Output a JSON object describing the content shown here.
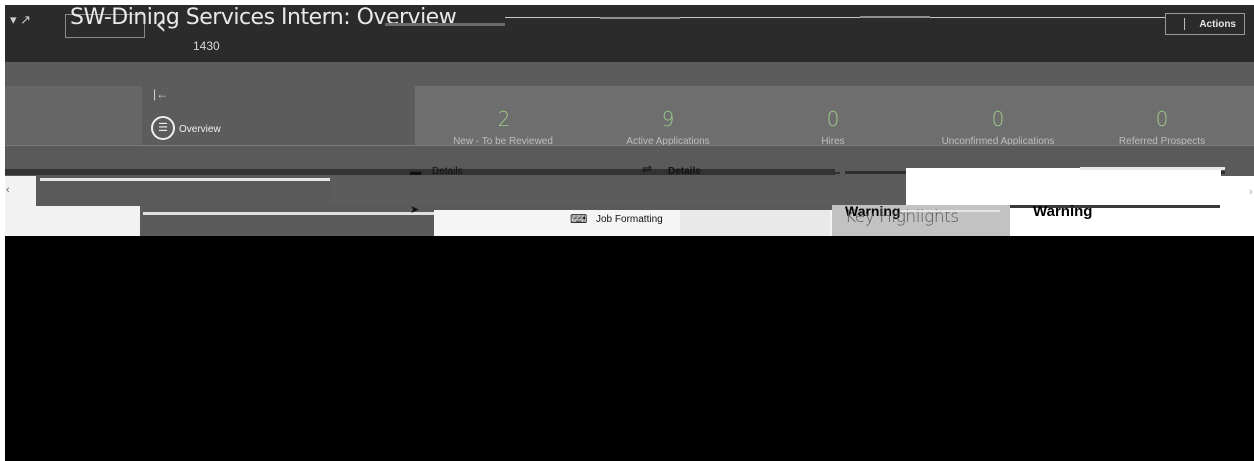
{
  "header": {
    "title": "SW-Dining Services Intern: Overview",
    "record_id": "1430",
    "actions_label": "Actions",
    "nav_icons": "▾ ↗"
  },
  "sidebar": {
    "collapse_icon": "|←",
    "overview_label": "Overview"
  },
  "stats": [
    {
      "value": "2",
      "label": "New - To be Reviewed"
    },
    {
      "value": "9",
      "label": "Active Applications"
    },
    {
      "value": "0",
      "label": "Hires"
    },
    {
      "value": "0",
      "label": "Unconfirmed Applications"
    },
    {
      "value": "0",
      "label": "Referred Prospects"
    }
  ],
  "tabs": {
    "details_tab": "Details",
    "details_link": "Details",
    "job_formatting": "Job Formatting",
    "key_highlights": "Key Highlights",
    "warning_left": "Warning",
    "warning_right": "Warning"
  },
  "colors": {
    "header_bg": "#2b2b2b",
    "stat_accent": "#9ccc8a",
    "workspace_bg": "#5c5c5c"
  }
}
